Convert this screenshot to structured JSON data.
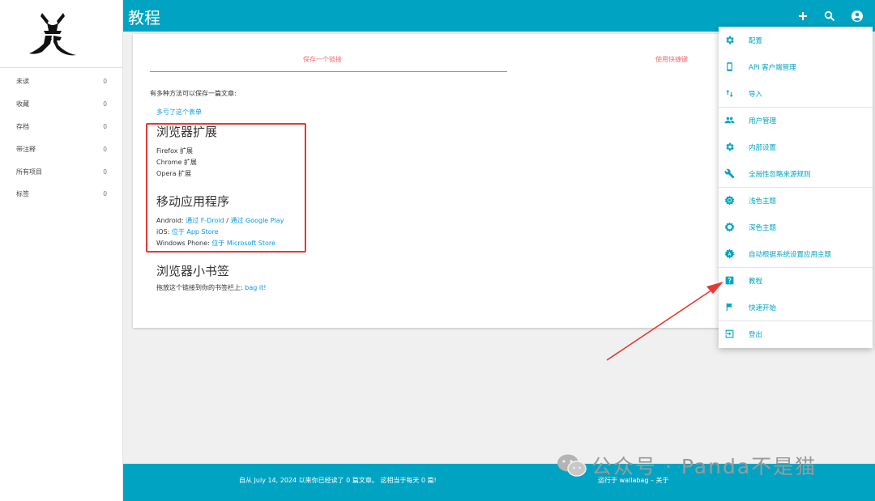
{
  "header": {
    "title": "教程"
  },
  "sidebar": {
    "items": [
      {
        "label": "未读",
        "count": "0"
      },
      {
        "label": "收藏",
        "count": "0"
      },
      {
        "label": "存档",
        "count": "0"
      },
      {
        "label": "带注释",
        "count": "0"
      },
      {
        "label": "所有项目",
        "count": "0"
      },
      {
        "label": "标签",
        "count": "0"
      }
    ]
  },
  "tabs": {
    "save_link": "保存一个链接",
    "shortcuts": "使用快捷键"
  },
  "content": {
    "intro": "有多种方法可以保存一篇文章:",
    "form_link": "多亏了这个表单",
    "browser_ext_heading": "浏览器扩展",
    "firefox": "Firefox 扩展",
    "chrome": "Chrome 扩展",
    "opera": "Opera 扩展",
    "mobile_heading": "移动应用程序",
    "android_label": "Android:",
    "fdroid": "通过 F-Droid",
    "sep": "/",
    "gplay": "通过 Google Play",
    "ios_label": "iOS:",
    "appstore": "位于 App Store",
    "wp_label": "Windows Phone:",
    "msstore": "位于 Microsoft Store",
    "bookmarklet_heading": "浏览器小书签",
    "bookmarklet_text": "拖放这个链接到你的书签栏上:",
    "bagit": "bag it!"
  },
  "menu": {
    "items": [
      {
        "label": "配置",
        "icon": "gear-icon"
      },
      {
        "label": "API 客户端管理",
        "icon": "phone-icon"
      },
      {
        "label": "导入",
        "icon": "import-arrows-icon"
      },
      {
        "label": "用户管理",
        "icon": "users-icon"
      },
      {
        "label": "内部设置",
        "icon": "gear-icon"
      },
      {
        "label": "全局性忽略来源规则",
        "icon": "wrench-icon"
      },
      {
        "label": "浅色主题",
        "icon": "sun-icon"
      },
      {
        "label": "深色主题",
        "icon": "sun-outline-icon"
      },
      {
        "label": "自动根据系统设置应用主题",
        "icon": "auto-theme-icon"
      },
      {
        "label": "教程",
        "icon": "help-icon"
      },
      {
        "label": "快速开始",
        "icon": "flag-icon"
      },
      {
        "label": "登出",
        "icon": "logout-icon"
      }
    ]
  },
  "footer": {
    "stats": "自从 July 14, 2024 以来你已经读了 0 篇文章。 这相当于每天 0 篇!",
    "powered_prefix": "运行于",
    "wallabag": "wallabag",
    "dash": "–",
    "about": "关于"
  },
  "watermark": {
    "text": "公众号 · Panda不是猫"
  },
  "colors": {
    "accent": "#00a4c2",
    "link": "#039be5",
    "tab": "#ee6e73",
    "annotation": "#e53935"
  }
}
